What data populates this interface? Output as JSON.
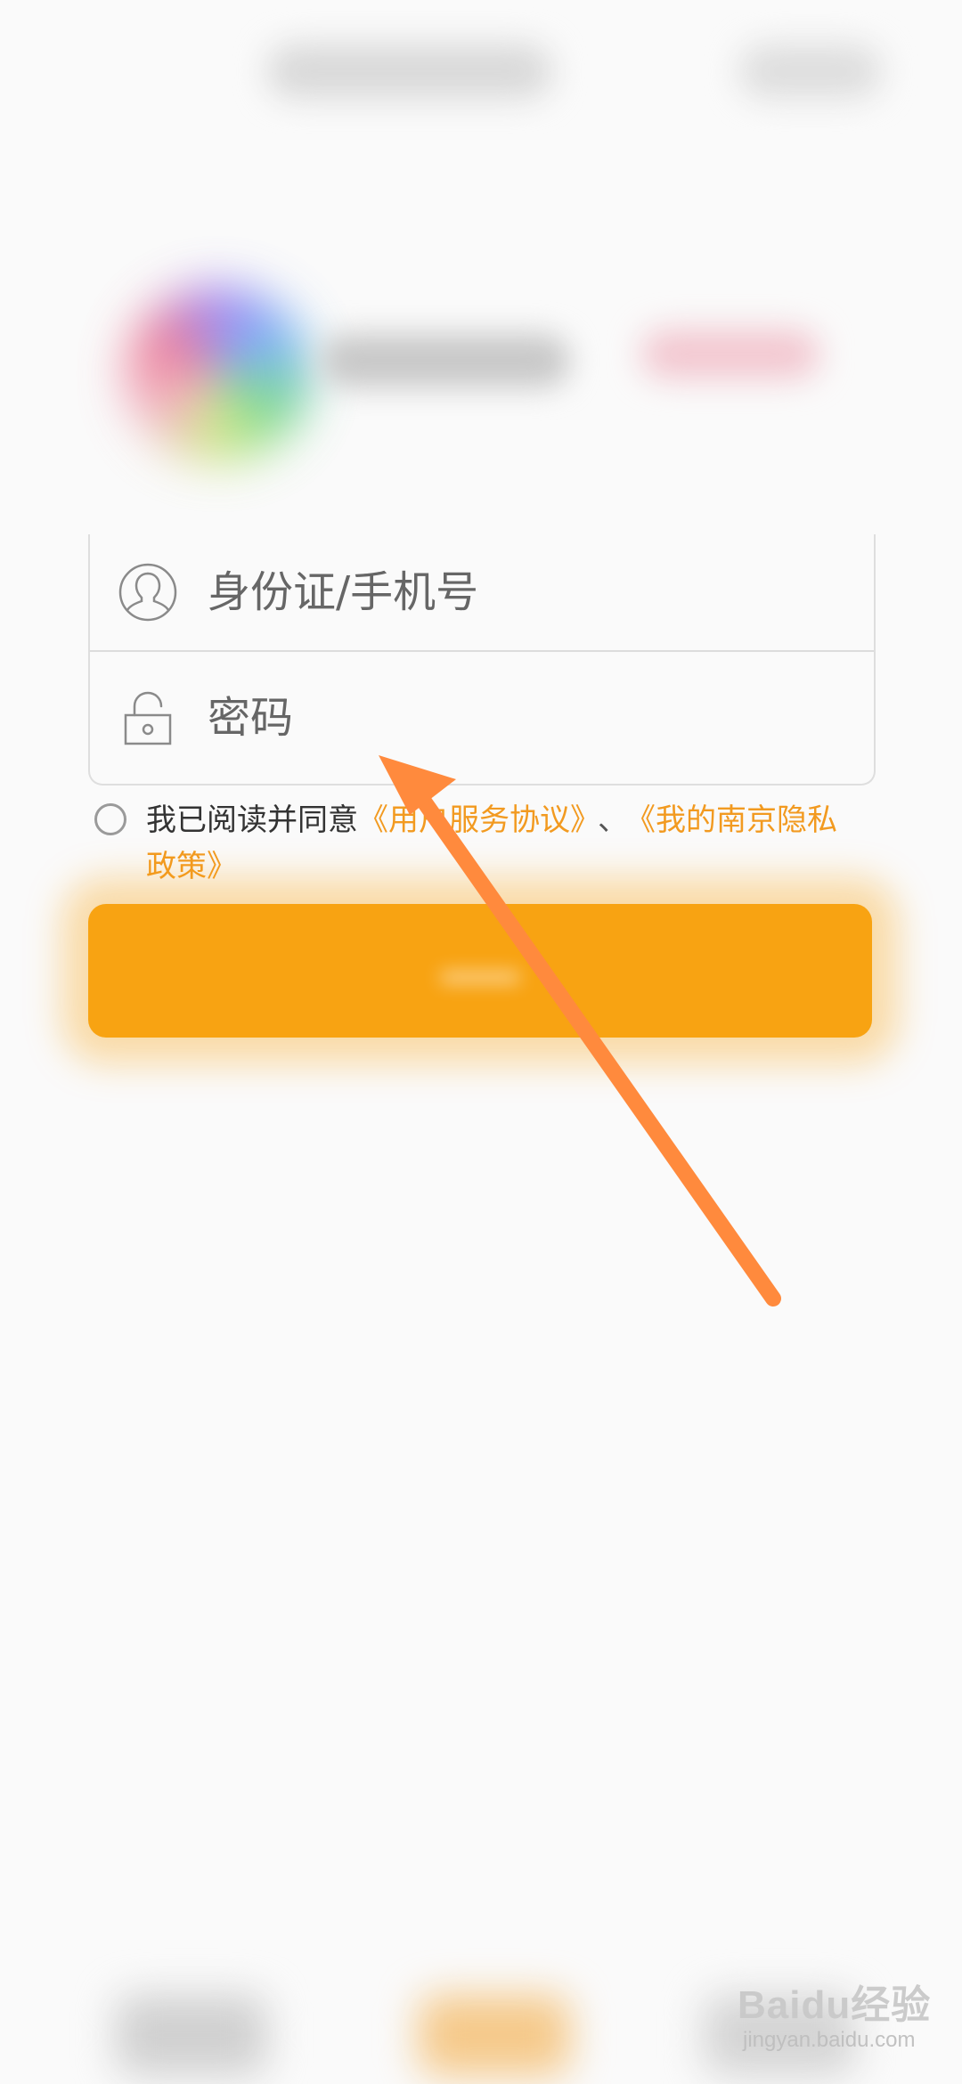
{
  "form": {
    "username_placeholder": "身份证/手机号",
    "password_placeholder": "密码",
    "user_icon": "user-avatar-icon",
    "lock_icon": "lock-icon"
  },
  "agreement": {
    "prefix": "我已阅读并同意",
    "link_service": "《用户服务协议》",
    "separator": "、",
    "link_privacy": "《我的南京隐私政策》",
    "checked": false
  },
  "colors": {
    "accent": "#f8a312",
    "link": "#f29a20",
    "arrow": "#ff8a3d"
  },
  "watermark": {
    "logo": "Baidu经验",
    "url": "jingyan.baidu.com"
  }
}
